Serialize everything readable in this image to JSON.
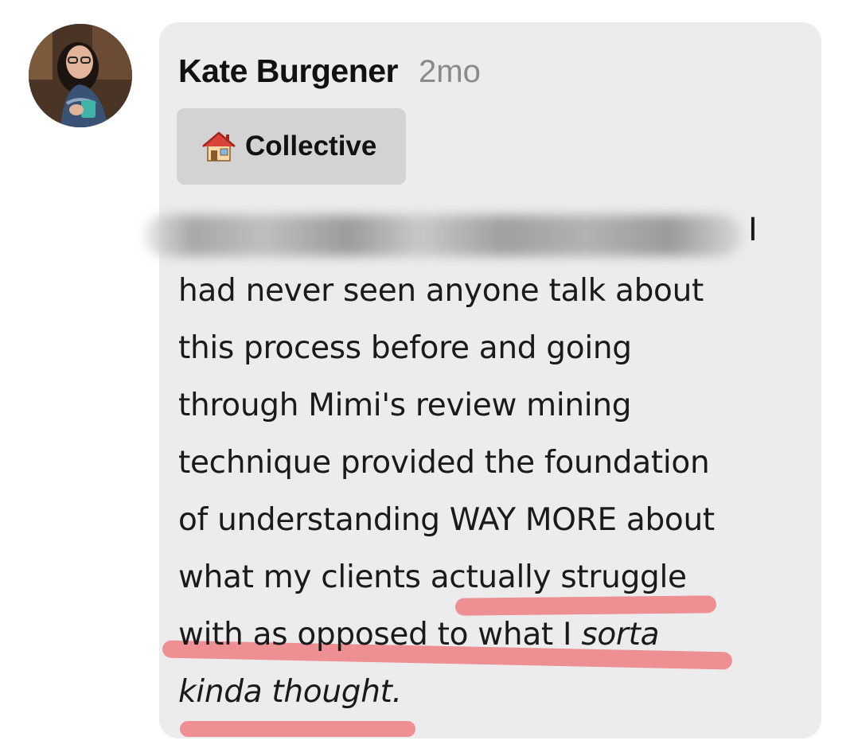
{
  "comment": {
    "author": "Kate Burgener",
    "age": "2mo",
    "tag": {
      "icon": "house-icon",
      "label": "Collective"
    },
    "blurred_tail": "I",
    "lines": [
      "had never seen anyone talk about",
      "this process before and going",
      "through Mimi's review mining",
      "technique provided the foundation",
      "of understanding WAY MORE about",
      "what my clients actually struggle",
      "with as opposed to what I",
      "sorta",
      "kinda thought."
    ]
  },
  "colors": {
    "bubble": "#ececec",
    "chip": "#d3d3d3",
    "highlight": "#ee7a7f",
    "muted": "#8a8a8a"
  }
}
